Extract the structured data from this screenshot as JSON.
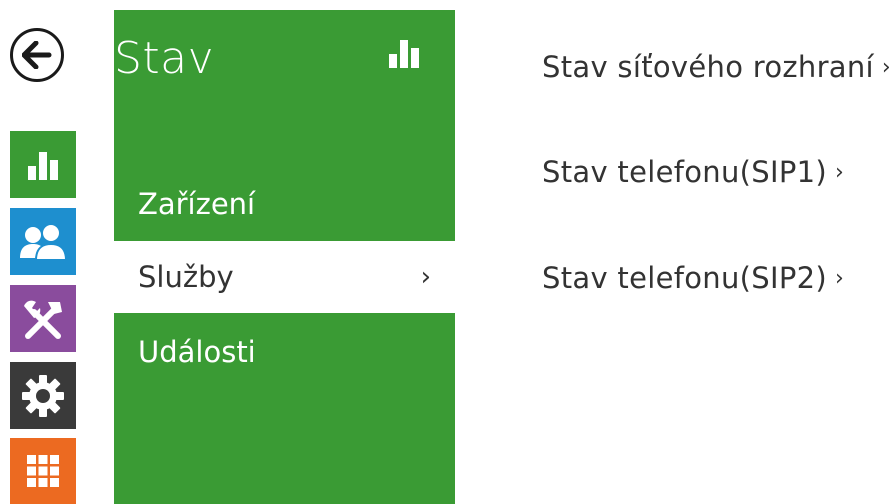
{
  "colors": {
    "green": "#3a9b34",
    "blue": "#1e8fcf",
    "purple": "#8a4c9d",
    "dark": "#3a3a3a",
    "orange": "#ec6a21"
  },
  "icons": {
    "back": "arrow-left-icon",
    "status": "bar-chart-icon",
    "users": "users-icon",
    "hardware": "hammer-wrench-icon",
    "settings": "gear-icon",
    "apps": "grid-icon"
  },
  "menu": {
    "title": "Stav",
    "items": [
      {
        "label": "Zařízení"
      },
      {
        "label": "Služby",
        "chevron": "›"
      },
      {
        "label": "Události"
      }
    ]
  },
  "content": {
    "links": [
      {
        "label": "Stav síťového rozhraní",
        "chevron": "›"
      },
      {
        "label": "Stav telefonu(SIP1)",
        "chevron": "›"
      },
      {
        "label": "Stav telefonu(SIP2)",
        "chevron": "›"
      }
    ]
  }
}
